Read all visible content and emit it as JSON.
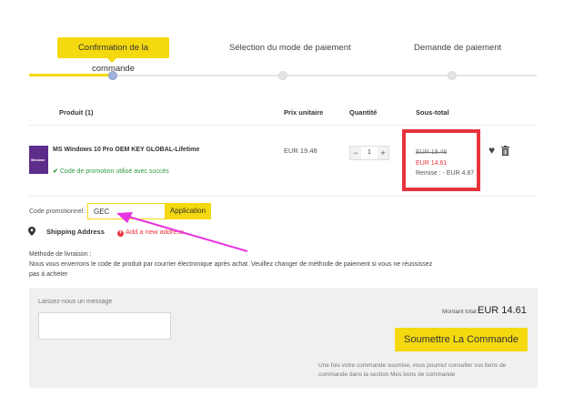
{
  "steps": [
    {
      "label": "Confirmation de la commande",
      "active": true
    },
    {
      "label": "Sélection du mode de paiement",
      "active": false
    },
    {
      "label": "Demande de paiement",
      "active": false
    }
  ],
  "table": {
    "headers": {
      "product": "Produit (1)",
      "unit_price": "Prix unitaire",
      "quantity": "Quantité",
      "subtotal": "Sous-total"
    }
  },
  "product": {
    "thumb_text": "Windows",
    "name": "MS Windows 10 Pro OEM KEY GLOBAL-Lifetime",
    "promo_status": "Code de promotion utilisé avec succès",
    "unit_price": "EUR 19.48",
    "quantity": "1",
    "old_price": "EUR 19.48",
    "new_price": "EUR 14.61",
    "discount": "Remise : - EUR 4.87"
  },
  "promo": {
    "label": "Code promotionnel :",
    "value": "GEC",
    "apply_label": "Application"
  },
  "shipping": {
    "label": "Shipping Address",
    "add_label": "Add a new address"
  },
  "delivery": {
    "title": "Méthode de livraison :",
    "text": "Nous vous enverrons le code de produit par courrier électronique après achat. Veuillez changer de méthode de paiement si vous ne réussissez pas à acheter"
  },
  "summary": {
    "message_label": "Laissez-nous un message",
    "total_label": "Montant total:",
    "total_value": "EUR 14.61",
    "submit_label": "Soumettre La Commande",
    "note": "Une fois votre commande soumise, vous pourrez consulter vos bons de commande dans la section Mes bons de commande"
  },
  "colors": {
    "accent": "#f5d90f",
    "highlight": "#e8343d",
    "success": "#2e9a3e",
    "annotation": "#e833e0"
  }
}
